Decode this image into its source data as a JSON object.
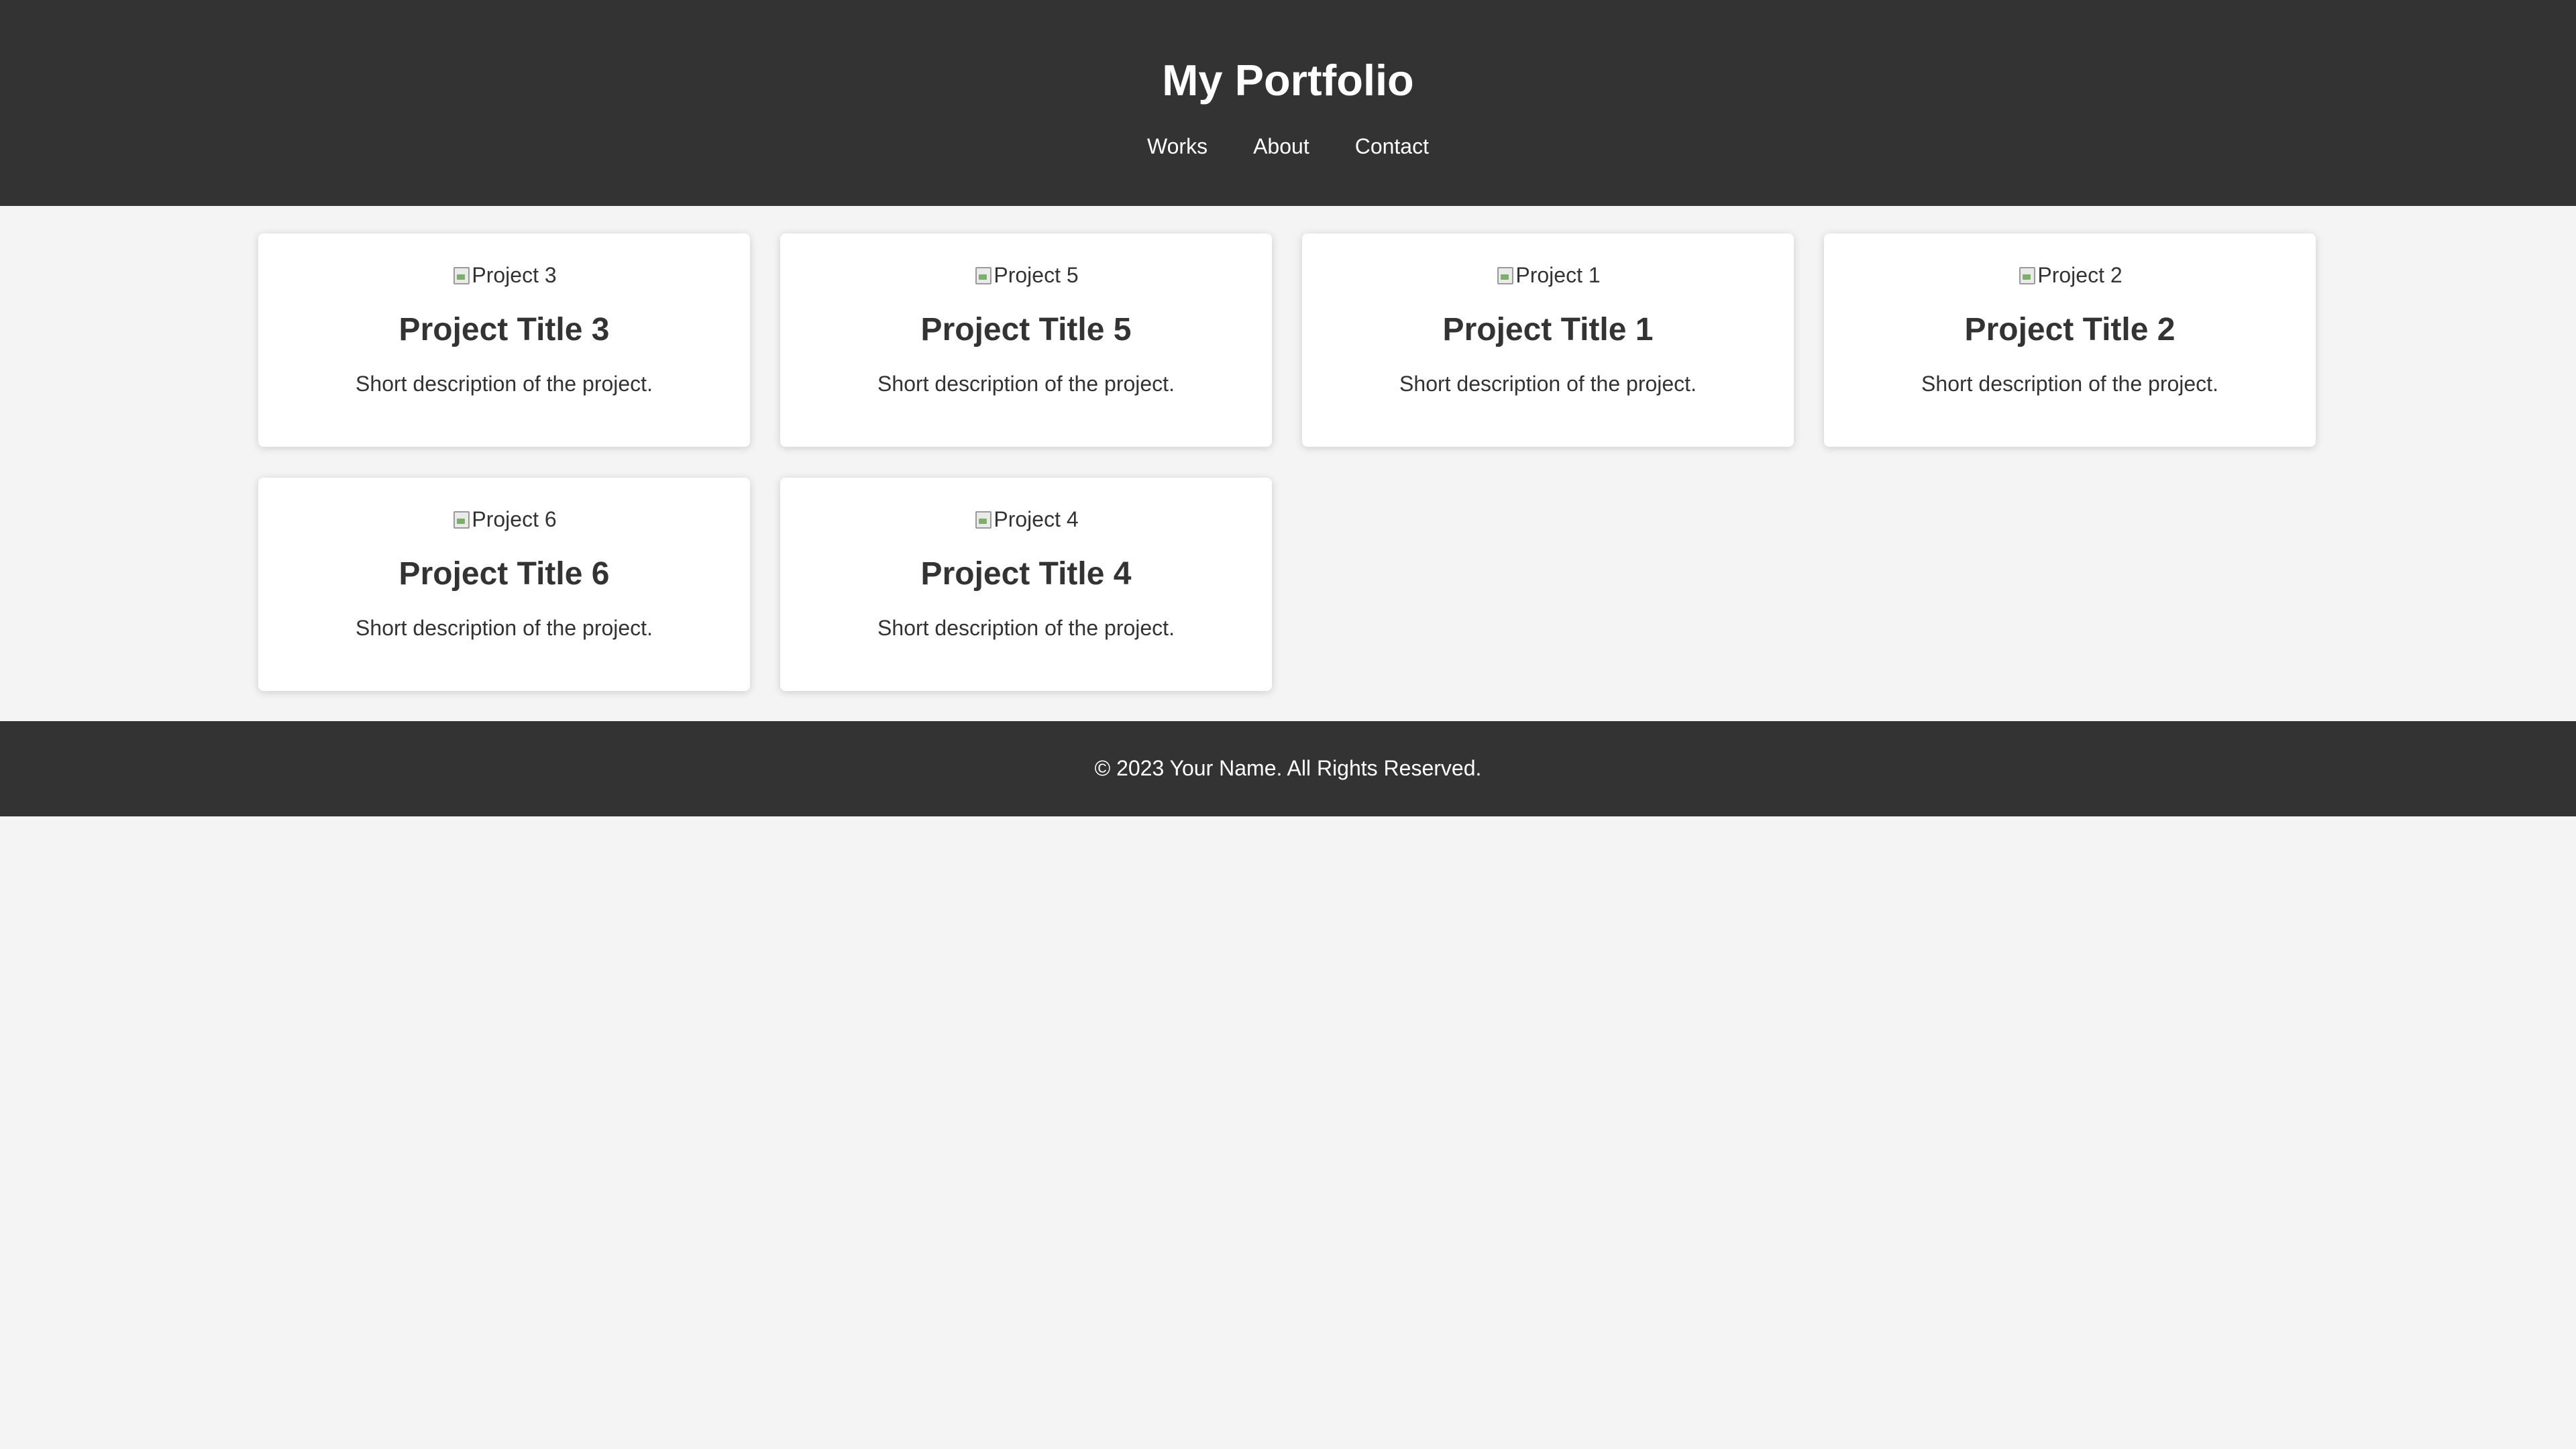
{
  "header": {
    "title": "My Portfolio",
    "nav": [
      "Works",
      "About",
      "Contact"
    ]
  },
  "projects": [
    {
      "image_alt": "Project 3",
      "title": "Project Title 3",
      "description": "Short description of the project."
    },
    {
      "image_alt": "Project 5",
      "title": "Project Title 5",
      "description": "Short description of the project."
    },
    {
      "image_alt": "Project 1",
      "title": "Project Title 1",
      "description": "Short description of the project."
    },
    {
      "image_alt": "Project 2",
      "title": "Project Title 2",
      "description": "Short description of the project."
    },
    {
      "image_alt": "Project 6",
      "title": "Project Title 6",
      "description": "Short description of the project."
    },
    {
      "image_alt": "Project 4",
      "title": "Project Title 4",
      "description": "Short description of the project."
    }
  ],
  "footer": {
    "copyright": "© 2023 Your Name. All Rights Reserved."
  },
  "colors": {
    "header_bg": "#333333",
    "page_bg": "#f4f4f4",
    "card_bg": "#ffffff",
    "text": "#333333"
  }
}
